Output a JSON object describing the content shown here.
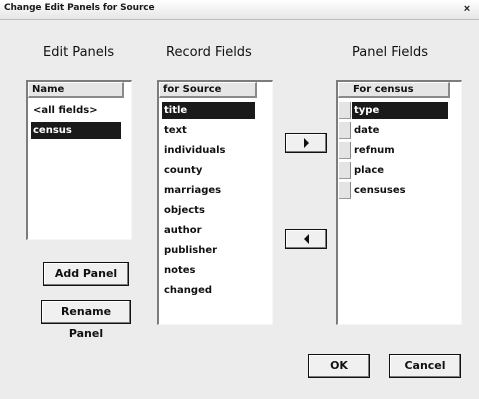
{
  "window": {
    "title": "Change Edit Panels for Source",
    "close_label": "×"
  },
  "edit_panels": {
    "heading": "Edit Panels",
    "column_header": "Name",
    "items": [
      {
        "label": "<all fields>",
        "selected": false
      },
      {
        "label": "census",
        "selected": true
      }
    ],
    "add_button": "Add Panel",
    "rename_button": "Rename Panel"
  },
  "record_fields": {
    "heading": "Record Fields",
    "column_header": "for Source",
    "items": [
      {
        "label": "title",
        "selected": true
      },
      {
        "label": "text",
        "selected": false
      },
      {
        "label": "individuals",
        "selected": false
      },
      {
        "label": "county",
        "selected": false
      },
      {
        "label": "marriages",
        "selected": false
      },
      {
        "label": "objects",
        "selected": false
      },
      {
        "label": "author",
        "selected": false
      },
      {
        "label": "publisher",
        "selected": false
      },
      {
        "label": "notes",
        "selected": false
      },
      {
        "label": "changed",
        "selected": false
      }
    ]
  },
  "panel_fields": {
    "heading": "Panel Fields",
    "column_header": "For census",
    "items": [
      {
        "label": "type",
        "selected": true
      },
      {
        "label": "date",
        "selected": false
      },
      {
        "label": "refnum",
        "selected": false
      },
      {
        "label": "place",
        "selected": false
      },
      {
        "label": "censuses",
        "selected": false
      }
    ]
  },
  "buttons": {
    "ok": "OK",
    "cancel": "Cancel"
  },
  "icons": {
    "add_arrow": "triangle-right-icon",
    "remove_arrow": "triangle-left-icon"
  }
}
